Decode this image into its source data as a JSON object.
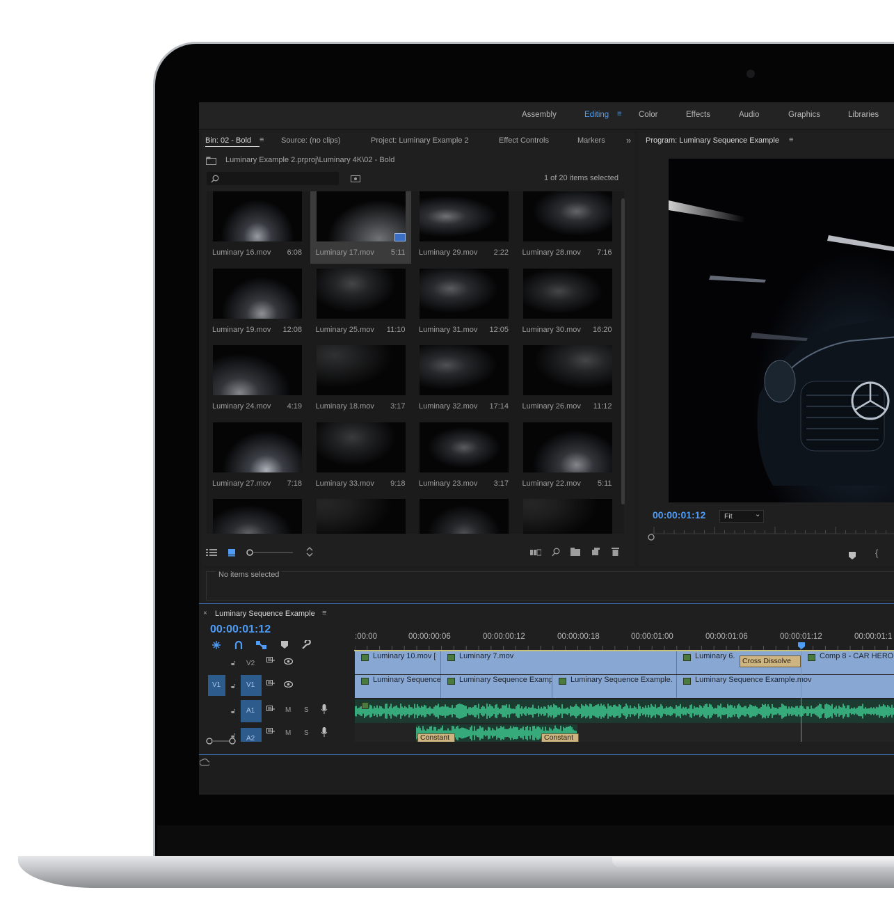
{
  "workspaces": {
    "items": [
      "Assembly",
      "Editing",
      "Color",
      "Effects",
      "Audio",
      "Graphics",
      "Libraries"
    ],
    "active": "Editing"
  },
  "bin": {
    "tabs": {
      "bin": "Bin: 02 - Bold",
      "source": "Source: (no clips)",
      "project": "Project: Luminary Example 2",
      "effect_controls": "Effect Controls",
      "markers": "Markers"
    },
    "path": "Luminary Example 2.prproj\\Luminary 4K\\02 - Bold",
    "search_placeholder": "",
    "selection_count": "1 of 20 items selected",
    "clips": [
      {
        "name": "Luminary 16.mov",
        "duration": "6:08"
      },
      {
        "name": "Luminary 17.mov",
        "duration": "5:11"
      },
      {
        "name": "Luminary 29.mov",
        "duration": "2:22"
      },
      {
        "name": "Luminary 28.mov",
        "duration": "7:16"
      },
      {
        "name": "Luminary 19.mov",
        "duration": "12:08"
      },
      {
        "name": "Luminary 25.mov",
        "duration": "11:10"
      },
      {
        "name": "Luminary 31.mov",
        "duration": "12:05"
      },
      {
        "name": "Luminary 30.mov",
        "duration": "16:20"
      },
      {
        "name": "Luminary 24.mov",
        "duration": "4:19"
      },
      {
        "name": "Luminary 18.mov",
        "duration": "3:17"
      },
      {
        "name": "Luminary 32.mov",
        "duration": "17:14"
      },
      {
        "name": "Luminary 26.mov",
        "duration": "11:12"
      },
      {
        "name": "Luminary 27.mov",
        "duration": "7:18"
      },
      {
        "name": "Luminary 33.mov",
        "duration": "9:18"
      },
      {
        "name": "Luminary 23.mov",
        "duration": "3:17"
      },
      {
        "name": "Luminary 22.mov",
        "duration": "5:11"
      }
    ],
    "selected_clip": "Luminary 17.mov"
  },
  "info": {
    "text": "No items selected"
  },
  "program": {
    "title": "Program: Luminary Sequence Example",
    "timecode": "00:00:01:12",
    "zoom": "Fit"
  },
  "timeline": {
    "title": "Luminary Sequence Example",
    "close": "×",
    "timecode": "00:00:01:12",
    "ruler": [
      ":00:00",
      "00:00:00:06",
      "00:00:00:12",
      "00:00:00:18",
      "00:00:01:00",
      "00:00:01:06",
      "00:00:01:12",
      "00:00:01:1"
    ],
    "tracks": {
      "v2": "V2",
      "v1": "V1",
      "v1_source": "V1",
      "a1": "A1",
      "a2": "A2",
      "mute": "M",
      "solo": "S"
    },
    "v2_clips": [
      "Luminary 10.mov [",
      "Luminary 7.mov",
      "Luminary 6.",
      "Comp 8 - CAR HERO"
    ],
    "v1_clips": [
      "Luminary Sequence",
      "Luminary Sequence Examp",
      "Luminary Sequence Example.",
      "Luminary Sequence Example.mov"
    ],
    "transition": "Cross Dissolve",
    "audio_keyframes": [
      "Constant",
      "Constant"
    ]
  },
  "colors": {
    "accent_blue": "#4e9cf5",
    "clip_video": "#88a7d3",
    "clip_audio": "#3fcf94",
    "transition": "#cdb480"
  },
  "icons": [
    "folder-icon",
    "search-icon",
    "new-bin-icon",
    "list-view-icon",
    "icon-view-icon",
    "zoom-slider-icon",
    "sort-icon",
    "automate-icon",
    "find-icon",
    "new-folder-icon",
    "new-item-icon",
    "trash-icon",
    "marker-icon",
    "snap-icon",
    "wrench-icon",
    "lock-icon",
    "eye-icon",
    "mic-icon",
    "panel-menu-icon",
    "overflow-icon"
  ]
}
